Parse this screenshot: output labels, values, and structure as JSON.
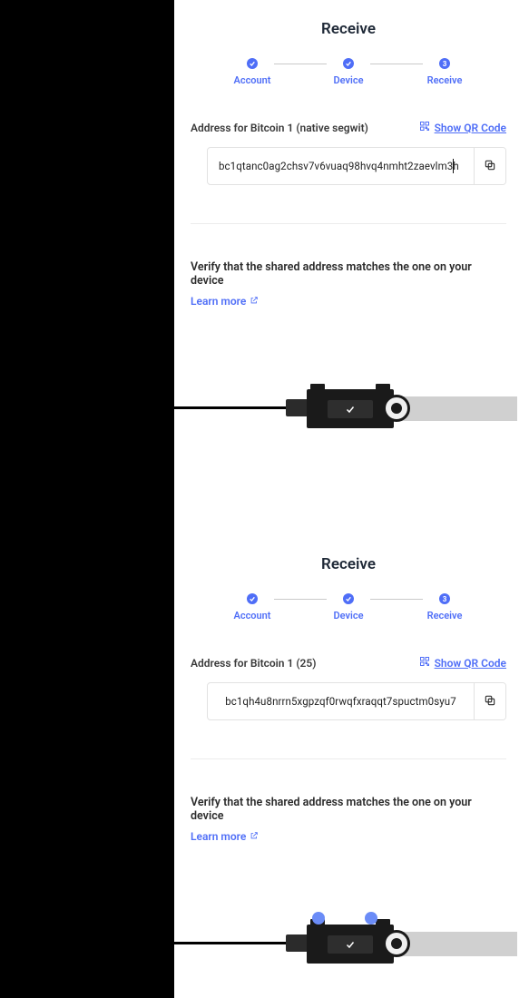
{
  "screens": [
    {
      "title": "Receive",
      "steps": [
        {
          "label": "Account",
          "state": "done"
        },
        {
          "label": "Device",
          "state": "done"
        },
        {
          "label": "Receive",
          "state": "active",
          "number": "3"
        }
      ],
      "address_label": "Address for Bitcoin 1 (native segwit)",
      "show_qr_label": "Show QR Code",
      "address_value": "bc1qtanc0ag2chsv7v6vuaq98hvq4nmht2zaevlm3h",
      "verify_text": "Verify that the shared address matches the one on your device",
      "learn_more_label": "Learn more",
      "show_blue_dots": false
    },
    {
      "title": "Receive",
      "steps": [
        {
          "label": "Account",
          "state": "done"
        },
        {
          "label": "Device",
          "state": "done"
        },
        {
          "label": "Receive",
          "state": "active",
          "number": "3"
        }
      ],
      "address_label": "Address for Bitcoin 1 (25)",
      "show_qr_label": "Show QR Code",
      "address_value": "bc1qh4u8nrrn5xgpzqf0rwqfxraqqt7spuctm0syu7",
      "verify_text": "Verify that the shared address matches the one on your device",
      "learn_more_label": "Learn more",
      "show_blue_dots": true
    }
  ],
  "colors": {
    "accent": "#4F6EF7"
  },
  "icons": {
    "check": "check-icon",
    "qr": "qr-icon",
    "copy": "copy-icon",
    "external": "external-link-icon"
  }
}
